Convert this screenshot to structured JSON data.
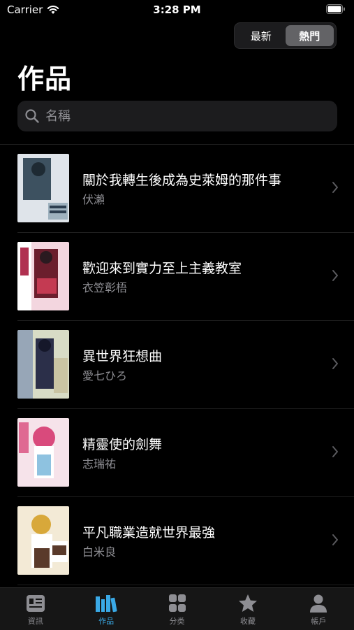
{
  "status": {
    "carrier": "Carrier",
    "time": "3:28 PM"
  },
  "segments": [
    {
      "label": "最新",
      "active": false
    },
    {
      "label": "熱門",
      "active": true
    }
  ],
  "title": "作品",
  "search": {
    "placeholder": "名稱",
    "value": ""
  },
  "books": [
    {
      "title": "關於我轉生後成為史萊姆的那件事",
      "author": "伏瀨",
      "cover_colors": [
        "#dfe4ea",
        "#3d5160",
        "#9fb2bf"
      ]
    },
    {
      "title": "歡迎來到實力至上主義教室",
      "author": "衣笠彰梧",
      "cover_colors": [
        "#f3d6df",
        "#6b1e2d",
        "#c43a52"
      ]
    },
    {
      "title": "異世界狂想曲",
      "author": "愛七ひろ",
      "cover_colors": [
        "#d8dcc6",
        "#2b2f49",
        "#7c8fb0"
      ]
    },
    {
      "title": "精靈使的劍舞",
      "author": "志瑞祐",
      "cover_colors": [
        "#f6e3ea",
        "#d94a7c",
        "#8ec2e0"
      ]
    },
    {
      "title": "平凡職業造就世界最強",
      "author": "白米良",
      "cover_colors": [
        "#f3ead6",
        "#d8a83a",
        "#5a3a2a"
      ]
    }
  ],
  "tabs": [
    {
      "label": "資訊",
      "icon": "news-icon",
      "active": false
    },
    {
      "label": "作品",
      "icon": "books-icon",
      "active": true
    },
    {
      "label": "分类",
      "icon": "grid-icon",
      "active": false
    },
    {
      "label": "收藏",
      "icon": "star-icon",
      "active": false
    },
    {
      "label": "帳戶",
      "icon": "person-icon",
      "active": false
    }
  ],
  "colors": {
    "accent": "#3aa9e6",
    "background": "#000000",
    "secondary_text": "#8e8e93"
  }
}
